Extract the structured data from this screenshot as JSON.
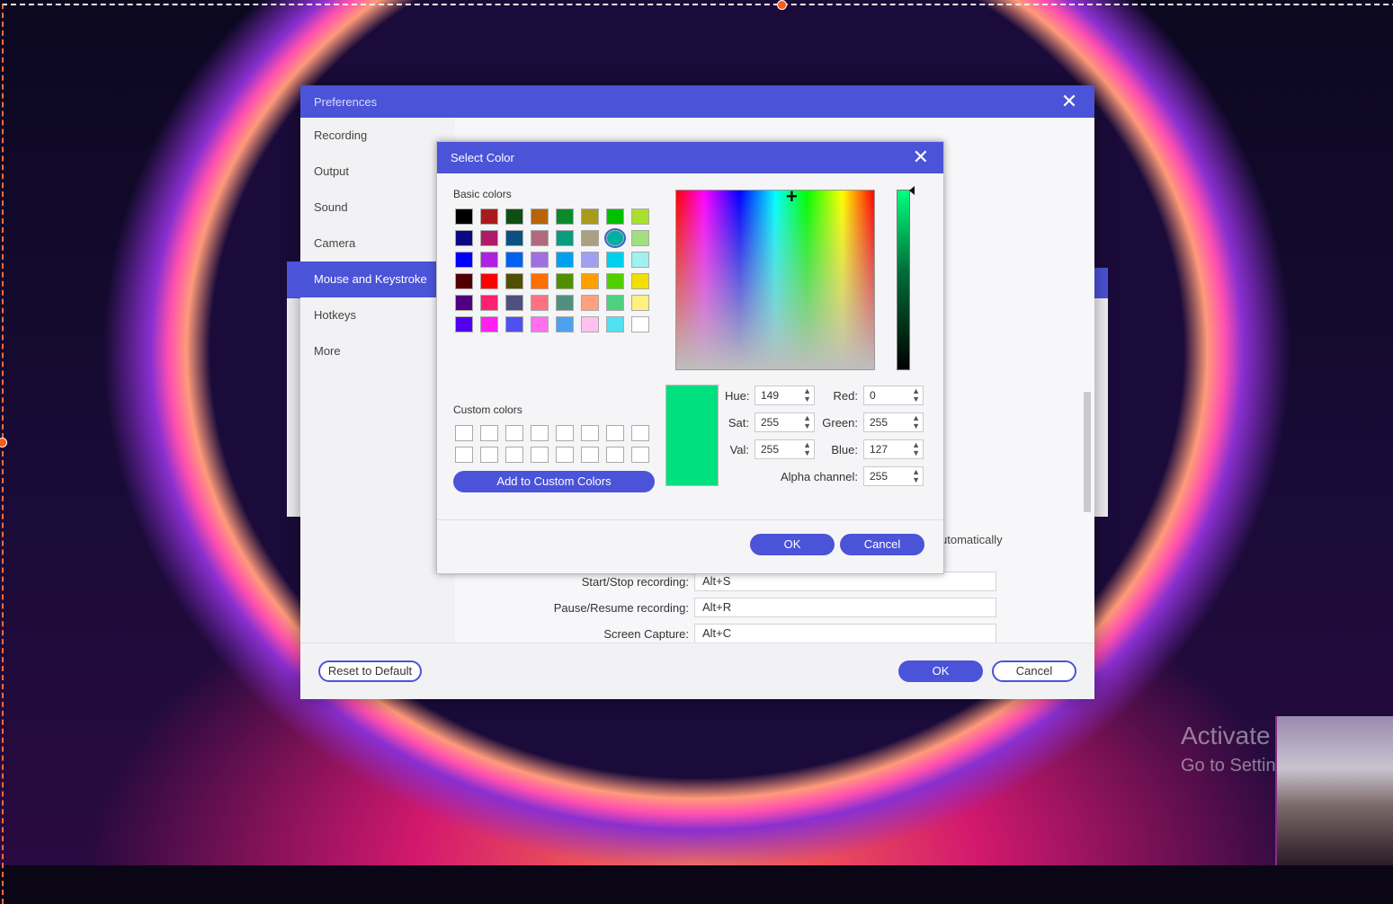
{
  "colors": {
    "accent": "#4b53d8",
    "current_color": "#00e07f"
  },
  "preferences": {
    "title": "Preferences",
    "sidebar": [
      {
        "label": "Recording"
      },
      {
        "label": "Output"
      },
      {
        "label": "Sound"
      },
      {
        "label": "Camera"
      },
      {
        "label": "Mouse and Keystroke",
        "active": true
      },
      {
        "label": "Hotkeys"
      },
      {
        "label": "More"
      }
    ],
    "auto_text_fragment": "utomatically",
    "hotkeys": [
      {
        "label": "Start/Stop recording:",
        "value": "Alt+S"
      },
      {
        "label": "Pause/Resume recording:",
        "value": "Alt+R"
      },
      {
        "label": "Screen Capture:",
        "value": "Alt+C"
      }
    ],
    "reset_label": "Reset to Default",
    "ok_label": "OK",
    "cancel_label": "Cancel"
  },
  "color_dialog": {
    "title": "Select Color",
    "basic_colors_label": "Basic colors",
    "custom_colors_label": "Custom colors",
    "basic_colors": [
      "#000000",
      "#aa1a1a",
      "#0f4d14",
      "#b8620a",
      "#0a8a2a",
      "#a89a1a",
      "#00c000",
      "#a8e030",
      "#0a0a80",
      "#b01a6a",
      "#0a5080",
      "#b06a80",
      "#0a9a80",
      "#a8a080",
      "#00b0a0",
      "#a0e080",
      "#0000ff",
      "#b020e0",
      "#0060f0",
      "#a070e0",
      "#00a0f0",
      "#a0a0f0",
      "#00d0f0",
      "#a0f0f0",
      "#500000",
      "#ff0000",
      "#505000",
      "#ff7000",
      "#509000",
      "#ffa000",
      "#50d000",
      "#f0e000",
      "#500080",
      "#ff2070",
      "#505080",
      "#ff7080",
      "#509080",
      "#ffa080",
      "#50d080",
      "#fff080",
      "#5000f0",
      "#ff20f0",
      "#5050f0",
      "#ff70f0",
      "#50a0f0",
      "#ffc0f0",
      "#50e0f0",
      "#ffffff"
    ],
    "selected_swatch_index": 14,
    "hue_label": "Hue:",
    "hue": "149",
    "sat_label": "Sat:",
    "sat": "255",
    "val_label": "Val:",
    "val": "255",
    "red_label": "Red:",
    "red": "0",
    "green_label": "Green:",
    "green": "255",
    "blue_label": "Blue:",
    "blue": "127",
    "alpha_label": "Alpha channel:",
    "alpha": "255",
    "add_custom_label": "Add to Custom Colors",
    "ok_label": "OK",
    "cancel_label": "Cancel"
  },
  "watermark": {
    "line1": "Activate Windows",
    "line2": "Go to Settings to activate"
  }
}
